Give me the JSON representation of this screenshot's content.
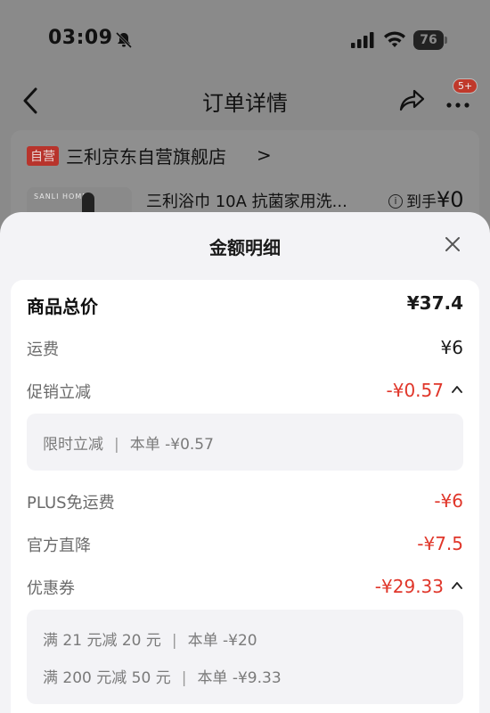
{
  "status_bar": {
    "time": "03:09",
    "battery": "76"
  },
  "nav": {
    "title": "订单详情",
    "badge": "5+"
  },
  "store": {
    "badge": "自营",
    "name": "三利京东自营旗舰店",
    "chevron": ">",
    "thumb_brand": "SANLI HOME",
    "product_name": "三利浴巾 10A 抗菌家用洗...",
    "price_prefix": "到手",
    "price_value": "¥0"
  },
  "sheet": {
    "title": "金额明细",
    "rows": [
      {
        "label": "商品总价",
        "value": "¥37.4"
      },
      {
        "label": "运费",
        "value": "¥6"
      },
      {
        "label": "促销立减",
        "value": "-¥0.57"
      },
      {
        "label": "PLUS免运费",
        "value": "-¥6"
      },
      {
        "label": "官方直降",
        "value": "-¥7.5"
      },
      {
        "label": "优惠券",
        "value": "-¥29.33"
      }
    ],
    "promo_details": [
      {
        "name": "限时立减",
        "sep": "|",
        "amount": "本单 -¥0.57"
      }
    ],
    "coupon_details": [
      {
        "name": "满 21 元减 20 元",
        "sep": "|",
        "amount": "本单 -¥20"
      },
      {
        "name": "满 200 元减 50 元",
        "sep": "|",
        "amount": "本单 -¥9.33"
      }
    ]
  },
  "colors": {
    "accent_red": "#e0362a",
    "sheet_bg": "#f3f3f6",
    "overlay": "#8a8a8a"
  },
  "icons": [
    "bell-slash-icon",
    "signal-icon",
    "wifi-icon",
    "battery-icon",
    "back-icon",
    "share-icon",
    "more-icon",
    "close-icon",
    "caret-up-icon",
    "info-icon"
  ]
}
